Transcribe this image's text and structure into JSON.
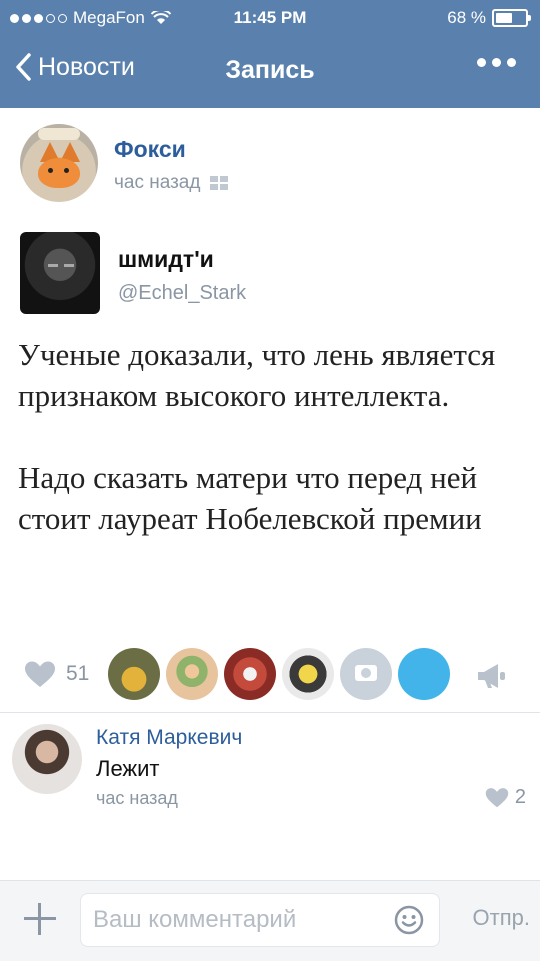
{
  "status_bar": {
    "carrier": "MegaFon",
    "time": "11:45 PM",
    "battery_label": "68 %",
    "battery_level": 0.68
  },
  "nav": {
    "back_label": "Новости",
    "title": "Запись"
  },
  "post": {
    "author_name": "Фокси",
    "time": "час назад"
  },
  "tweet": {
    "name": "шмидт'и",
    "handle": "@Echel_Stark",
    "paragraphs": [
      "Ученые доказали, что лень является признаком высокого интеллекта.",
      "Надо сказать матери что перед ней стоит лауреат Нобелевской премии"
    ]
  },
  "actions": {
    "likes_count": "51"
  },
  "comment": {
    "author": "Катя Маркевич",
    "text": "Лежит",
    "time": "час назад",
    "likes": "2"
  },
  "input": {
    "placeholder": "Ваш комментарий",
    "send_label": "Отпр."
  },
  "colors": {
    "header": "#5a81ad",
    "link": "#2d5e9c",
    "muted": "#8a96a3"
  }
}
